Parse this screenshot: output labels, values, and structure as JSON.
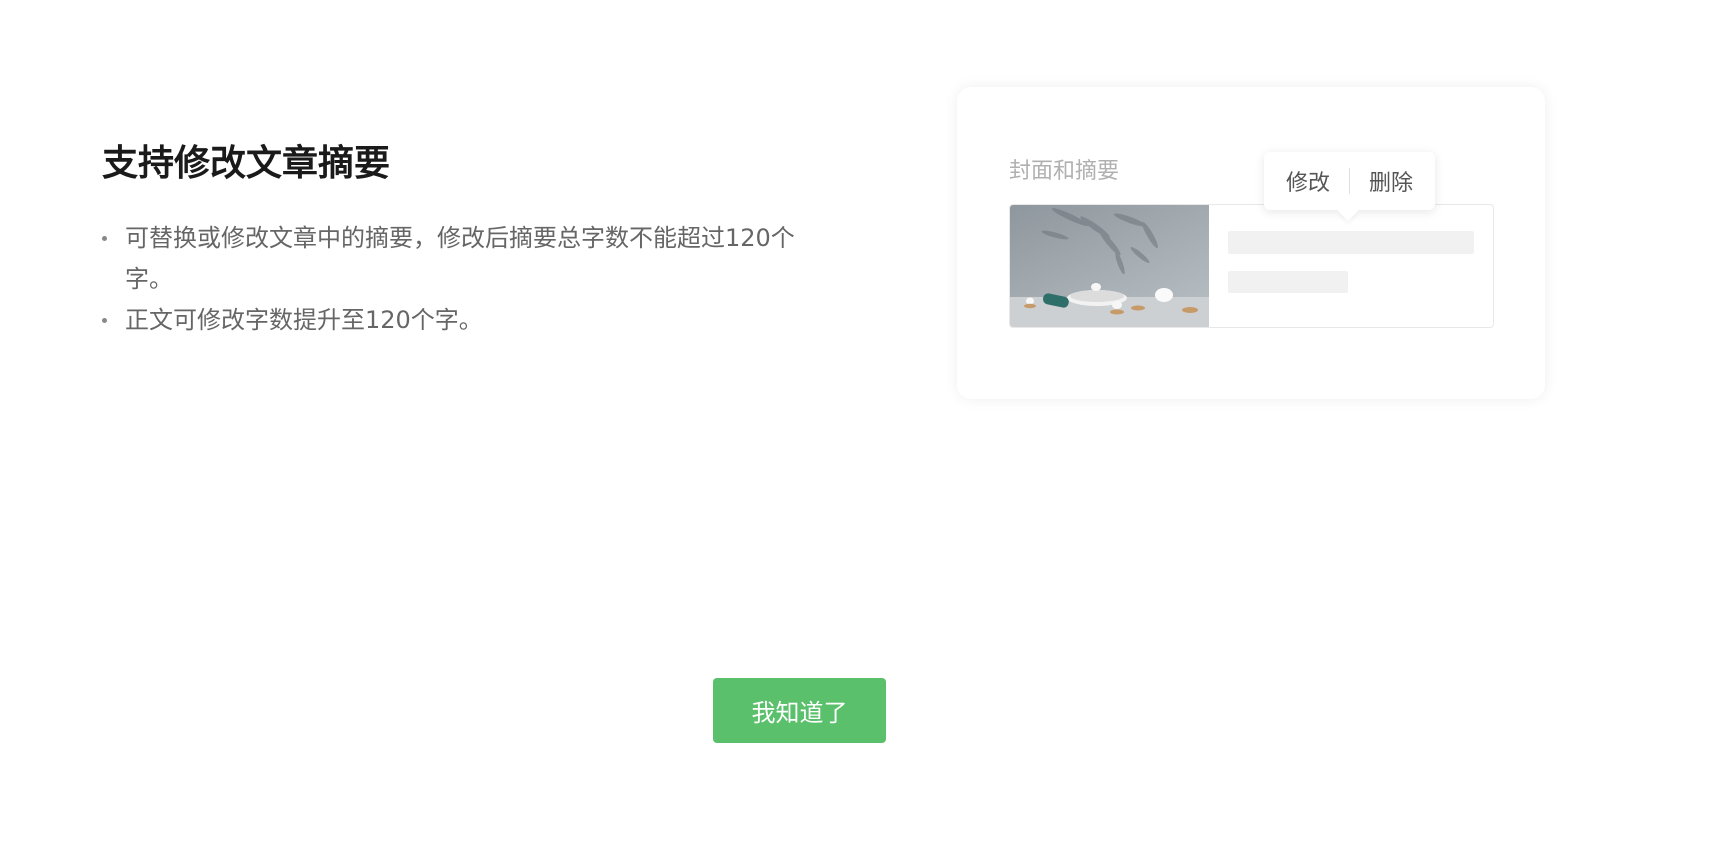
{
  "title": "支持修改文章摘要",
  "bullets": [
    "可替换或修改文章中的摘要，修改后摘要总字数不能超过120个字。",
    "正文可修改字数提升至120个字。"
  ],
  "preview_card": {
    "label": "封面和摘要",
    "popover": {
      "edit_label": "修改",
      "delete_label": "删除"
    },
    "thumbnail_icon": "tea-set-photo"
  },
  "confirm_button": {
    "label": "我知道了",
    "color": "#5ac06c"
  }
}
